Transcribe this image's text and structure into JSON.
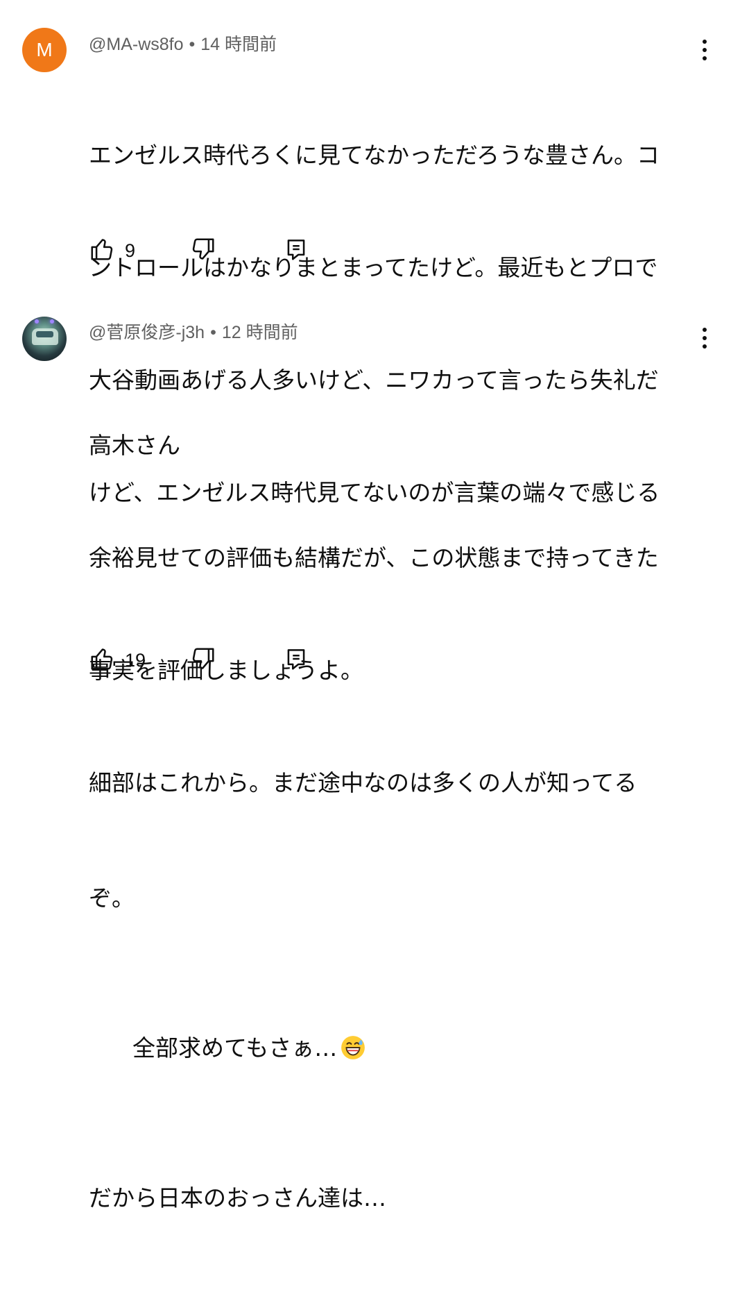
{
  "comments": [
    {
      "avatar_letter": "M",
      "avatar_color": "#f07818",
      "author": "@MA-ws8fo",
      "separator": "•",
      "time": "14 時間前",
      "body_lines": [
        "エンゼルス時代ろくに見てなかっただろうな豊さん。コ",
        "ントロールはかなりまとまってたけど。最近もとプロで",
        "大谷動画あげる人多いけど、ニワカって言ったら失礼だ",
        "けど、エンゼルス時代見てないのが言葉の端々で感じる"
      ],
      "likes": "9",
      "icons": [
        "like-icon",
        "dislike-icon",
        "reply-icon",
        "more-vert-icon"
      ]
    },
    {
      "avatar_image": "avatar-photo",
      "author": "@菅原俊彦-j3h",
      "separator": "•",
      "time": "12 時間前",
      "body_lines": [
        "高木さん",
        "余裕見せての評価も結構だが、この状態まで持ってきた",
        "事実を評価しましょうよ。",
        "細部はこれから。まだ途中なのは多くの人が知ってる",
        "ぞ。",
        "全部求めてもさぁ…",
        "だから日本のおっさん達は…"
      ],
      "emoji": "grinning-face-with-sweat-emoji",
      "likes": "19",
      "icons": [
        "like-icon",
        "dislike-icon",
        "reply-icon",
        "more-vert-icon"
      ]
    }
  ],
  "colors": {
    "text": "#0f0f0f",
    "meta": "#606060",
    "background": "#ffffff"
  }
}
